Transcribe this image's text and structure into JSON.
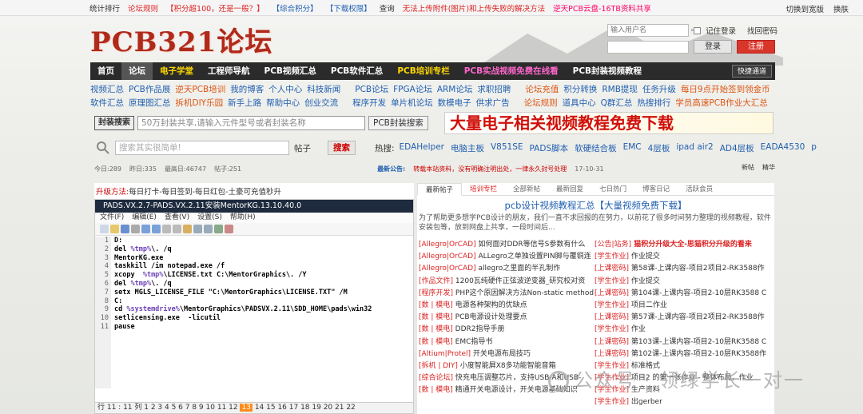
{
  "topbar": {
    "items": [
      "统计排行",
      "论坛规则",
      "【积分超100，还是一般？】",
      "【综合积分】",
      "【下载权限】",
      "查询",
      "无法上传附件(图片)和上传失败的解决方法",
      "逆天PCB云盘-16TB资料共享"
    ],
    "right": [
      "切换到宽版",
      "换肤"
    ]
  },
  "logo": "PCB321论坛",
  "login": {
    "username_placeholder": "输入用户名",
    "remember": "记住登录",
    "forgot": "找回密码",
    "login_btn": "登录",
    "register_btn": "注册"
  },
  "nav": {
    "items": [
      "首页",
      "论坛",
      "电子学堂",
      "工程师导航",
      "PCB视频汇总",
      "PCB软件汇总",
      "PCB培训专栏",
      "PCB实战视频免费在线看",
      "PCB封装视频教程"
    ],
    "quick": "快捷通道"
  },
  "links": {
    "row1": [
      "视频汇总",
      "PCB作品展",
      "逆天PCB培训",
      "我的博客",
      "个人中心",
      "科技新闻",
      "PCB论坛",
      "FPGA论坛",
      "ARM论坛",
      "求职招聘",
      "论坛充值",
      "积分转换",
      "RMB提现",
      "任务升级",
      "每日9点开始签到领金币"
    ],
    "row2": [
      "软件汇总",
      "原理图汇总",
      "拆机DIY乐园",
      "新手上路",
      "帮助中心",
      "创业交流",
      "程序开发",
      "单片机论坛",
      "数模电子",
      "供求广告",
      "论坛规则",
      "道具中心",
      "Q群汇总",
      "热搜排行",
      "学员高速PCB作业大汇总"
    ]
  },
  "search": {
    "label": "封装搜索",
    "placeholder": "50万封装共享,请输入元件型号或者封装名称",
    "button": "PCB封装搜索",
    "banner": "大量电子相关视频教程免费下载"
  },
  "hot": {
    "placeholder": "搜索其实很简单!",
    "type": "帖子",
    "button": "搜索",
    "label": "热搜:",
    "keywords": [
      "EDAHelper",
      "电脑主板",
      "V851SE",
      "PADS脚本",
      "软硬结合板",
      "EMC",
      "4层板",
      "ipad air2",
      "AD4层板",
      "EADA4530",
      "p"
    ]
  },
  "stats": {
    "today": "今日:289",
    "yesterday": "昨日:335",
    "max": "最高日:46747",
    "posts": "帖子:251",
    "notice_label": "最新公告:",
    "notice": "转载本站资料，没有明确注明出处，一律永久封号处理",
    "date": "17-10-31",
    "new": "新帖",
    "best": "精华"
  },
  "left": {
    "upgrade_label": "升级方法:",
    "upgrade_text": "每日打卡-每日签到-每日红包-土豪可充值秒升",
    "pads_title": "PADS.VX.2.7-PADS.VX.2.11安装MentorKG.13.10.40.0",
    "menu": [
      "文件(F)",
      "编辑(E)",
      "查看(V)",
      "设置(S)",
      "帮助(H)"
    ],
    "code_lines": [
      "D:",
      "del %tmp%\\. /q",
      "MentorKG.exe",
      "taskkill /im notepad.exe /f",
      "xcopy  %tmp%\\LICENSE.txt C:\\MentorGraphics\\. /Y",
      "del %tmp%\\. /q",
      "setx MGLS_LICENSE_FILE \"C:\\MentorGraphics\\LICENSE.TXT\" /M",
      "C:",
      "cd %systemdrive%\\MentorGraphics\\PADSVX.2.11\\SDD_HOME\\pads\\win32",
      "setlicensing.exe  -licutil",
      "pause"
    ],
    "status": "行 11 : 11  列 1  2 3 4 5 6 7 8 9 10 11 12",
    "status_mark": "13",
    "status_tail": "14 15 16 17 18 19 20 21 22"
  },
  "right": {
    "tabs": [
      "最新帖子",
      "培训专栏",
      "全部新帖",
      "最新回复",
      "七日热门",
      "博客日记",
      "活跃会员"
    ],
    "title": "pcb设计视频教程汇总【大量视频免费下载】",
    "intro": "为了帮助更多想学PCB设计的朋友，我们一直不求回报的在努力，以前花了很多时间努力整理的视频教程，软件安装包等，放到网盘上共享，一段时间后...",
    "left_items": [
      {
        "tag": "[Allegro|OrCAD]",
        "text": "如何面对DDR等信号S参数有什么"
      },
      {
        "tag": "[Allegro|OrCAD]",
        "text": "ALLegro之单独设置PIN脚与覆铜连"
      },
      {
        "tag": "[Allegro|OrCAD]",
        "text": "allegro之里面的半孔制作"
      },
      {
        "tag": "[作品文件]",
        "text": "1200瓦纯硬件正弦波逆变器_研究校对资"
      },
      {
        "tag": "[程序开发]",
        "text": "PHP这个原因解决方法Non-static method"
      },
      {
        "tag": "[数 | 模电]",
        "text": "电源各种架构的优缺点"
      },
      {
        "tag": "[数 | 模电]",
        "text": "PCB电源设计处理要点"
      },
      {
        "tag": "[数 | 模电]",
        "text": "DDR2指导手册"
      },
      {
        "tag": "[数 | 模电]",
        "text": "EMC指导书"
      },
      {
        "tag": "[Altium|Protel]",
        "text": "开关电源布局技巧"
      },
      {
        "tag": "[拆机 | DIY]",
        "text": "小度智能屏X8多功能智能音箱"
      },
      {
        "tag": "[综合论坛]",
        "text": "快充电压调整芯片，支持USB-A和USB-"
      },
      {
        "tag": "[数 | 模电]",
        "text": "精通开关电源设计，开关电源基础知识"
      }
    ],
    "right_items": [
      {
        "tag": "[公告|站务]",
        "text": "猫积分升级大全-思猫积分升级的看来"
      },
      {
        "tag": "[学生作业]",
        "text": "作业提交"
      },
      {
        "tag": "[上课密码]",
        "text": "第58课-上课内容-项目2项目2-RK3588作"
      },
      {
        "tag": "[学生作业]",
        "text": "作业提交"
      },
      {
        "tag": "[上课密码]",
        "text": "第104课-上课内容-项目2-10层RK3588 C"
      },
      {
        "tag": "[学生作业]",
        "text": "项目二作业"
      },
      {
        "tag": "[上课密码]",
        "text": "第57课-上课内容-项目2项目2-RK3588作"
      },
      {
        "tag": "[学生作业]",
        "text": "作业"
      },
      {
        "tag": "[上课密码]",
        "text": "第103课-上课内容-项目2-10层RK3588 C"
      },
      {
        "tag": "[上课密码]",
        "text": "第102课-上课内容-项目2-10层RK3588作"
      },
      {
        "tag": "[学生作业]",
        "text": "标准格式"
      },
      {
        "tag": "[学生作业]",
        "text": "项目2 的第一张作业 - 整体布局，作业"
      },
      {
        "tag": "[学生作业]",
        "text": "生产资料"
      },
      {
        "tag": "[学生作业]",
        "text": "出gerber"
      }
    ]
  },
  "watermark": "公众号 · 领绿学长一对一",
  "colors": {
    "red": "#d22222",
    "blue": "#1f5fb0",
    "nav": "#2b2b2b",
    "yellow": "#ffd800"
  }
}
